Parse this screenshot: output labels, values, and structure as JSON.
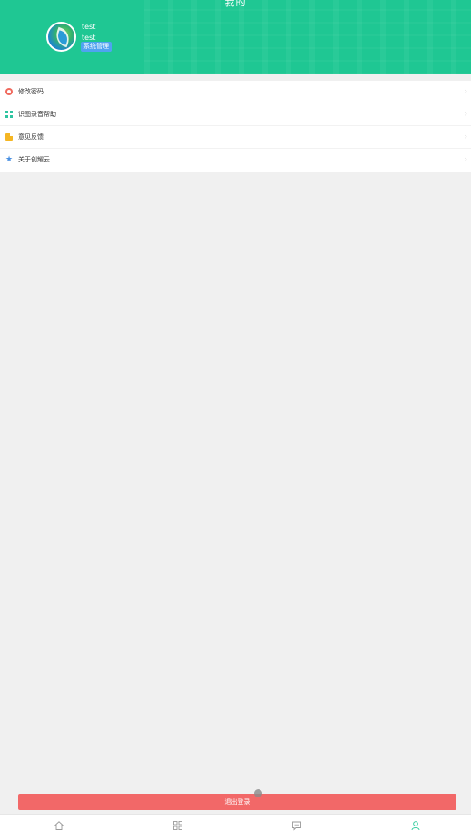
{
  "header": {
    "title": "我的",
    "user": {
      "name": "test",
      "account": "test",
      "badge": "系统管理"
    }
  },
  "menu": {
    "items": [
      {
        "label": "修改密码",
        "icon": "settings-icon"
      },
      {
        "label": "识图录音帮助",
        "icon": "grid-icon"
      },
      {
        "label": "意见反馈",
        "icon": "document-icon"
      },
      {
        "label": "关于创耀云",
        "icon": "star-icon"
      }
    ]
  },
  "logout_label": "退出登录",
  "tabbar": {
    "tabs": [
      {
        "icon": "home-icon"
      },
      {
        "icon": "apps-icon"
      },
      {
        "icon": "message-icon"
      },
      {
        "icon": "profile-icon",
        "active": true
      }
    ]
  },
  "colors": {
    "header": "#1fc793",
    "logout": "#f26868",
    "badge": "#4fa3f0",
    "active_tab": "#1fc793"
  }
}
